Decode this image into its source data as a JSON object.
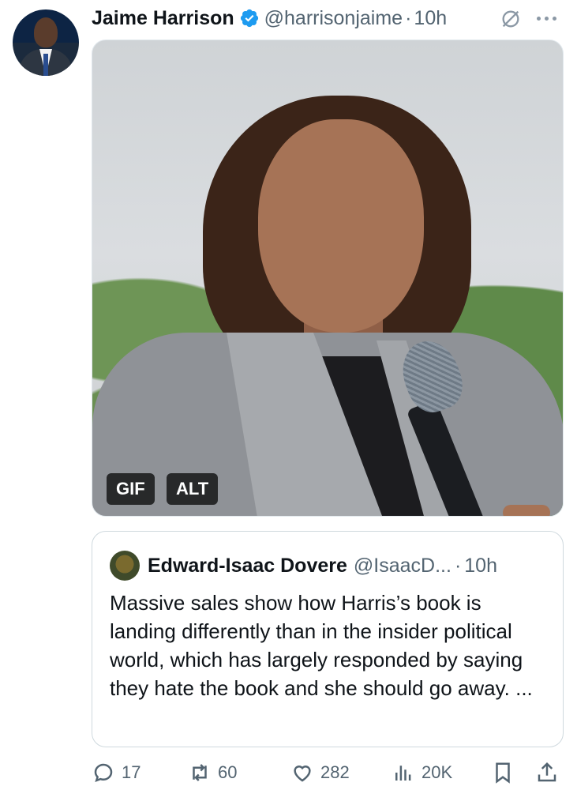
{
  "tweet": {
    "author_name": "Jaime Harrison",
    "author_handle": "@harrisonjaime",
    "separator": "·",
    "time": "10h",
    "icons": {
      "verified": "verified-badge-icon",
      "grok": "grok-icon",
      "more": "more-icon"
    },
    "media": {
      "badges": {
        "gif": "GIF",
        "alt": "ALT"
      }
    }
  },
  "quoted_tweet": {
    "author_name": "Edward-Isaac Dovere",
    "author_handle": "@IsaacD...",
    "separator": "·",
    "time": "10h",
    "text": "Massive sales show how Harris’s book is landing differently than in the insider political world, which has largely responded by saying they hate the book and she should go away. ..."
  },
  "actions": {
    "reply_count": "17",
    "repost_count": "60",
    "like_count": "282",
    "views_count": "20K"
  },
  "colors": {
    "accent": "#1d9bf0",
    "secondary_text": "#536471",
    "text": "#0f1419"
  }
}
